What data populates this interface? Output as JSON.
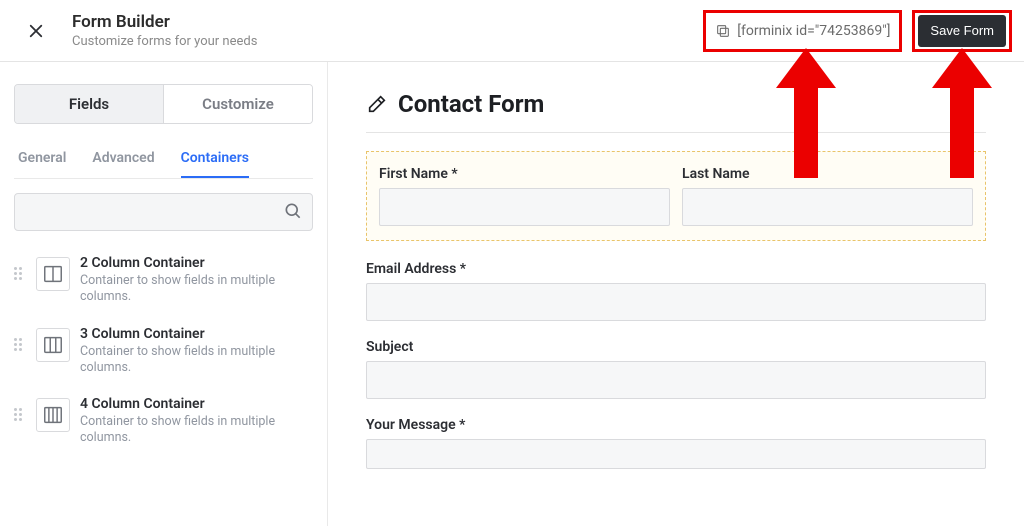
{
  "header": {
    "title": "Form Builder",
    "subtitle": "Customize forms for your needs",
    "embed_code": "[forminix id=\"74253869\"]",
    "save_label": "Save Form"
  },
  "sidebar": {
    "maintabs": {
      "fields": "Fields",
      "customize": "Customize"
    },
    "subtabs": {
      "general": "General",
      "advanced": "Advanced",
      "containers": "Containers"
    },
    "items": [
      {
        "title": "2 Column Container",
        "desc": "Container to show fields in multiple columns.",
        "cols": 2
      },
      {
        "title": "3 Column Container",
        "desc": "Container to show fields in multiple columns.",
        "cols": 3
      },
      {
        "title": "4 Column Container",
        "desc": "Container to show fields in multiple columns.",
        "cols": 4
      }
    ]
  },
  "form": {
    "title": "Contact Form",
    "fields": {
      "first_name": "First Name *",
      "last_name": "Last Name",
      "email": "Email Address *",
      "subject": "Subject",
      "message": "Your Message *"
    }
  }
}
